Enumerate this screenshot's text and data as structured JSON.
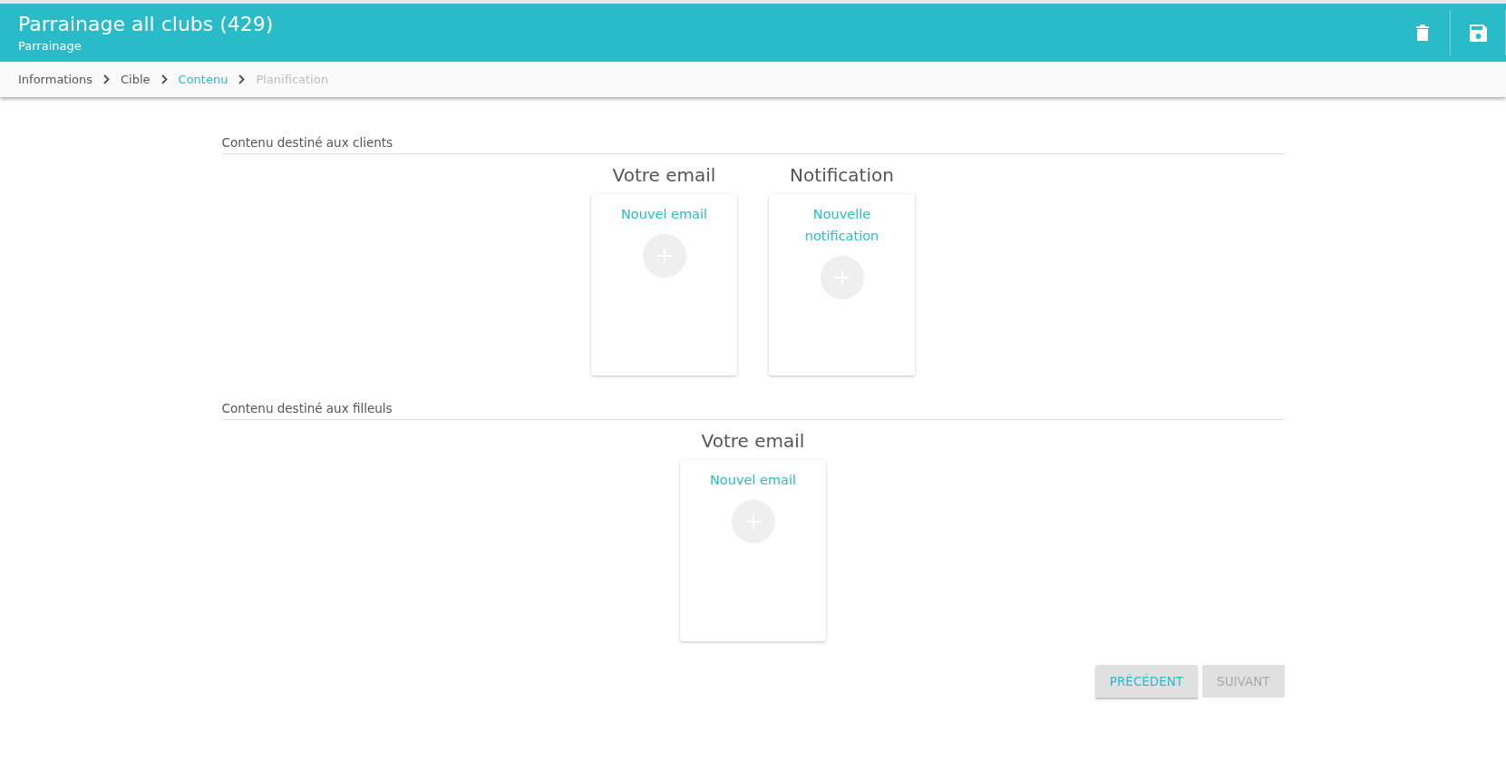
{
  "header": {
    "title": "Parrainage all clubs (429)",
    "subtitle": "Parrainage"
  },
  "toolbar": {
    "actions": [
      {
        "kind": "delete"
      },
      {
        "kind": "save"
      }
    ]
  },
  "breadcrumb": [
    {
      "label": "Informations",
      "selected": false,
      "disabled": false
    },
    {
      "label": "Cible",
      "selected": false,
      "disabled": false
    },
    {
      "label": "Contenu",
      "selected": true,
      "disabled": false
    },
    {
      "label": "Planification",
      "selected": false,
      "disabled": true
    }
  ],
  "sections": [
    {
      "title": "Contenu destiné aux clients",
      "cards": [
        {
          "heading": "Votre email",
          "label": "Nouvel email"
        },
        {
          "heading": "Notification",
          "label": "Nouvelle notification"
        }
      ]
    },
    {
      "title": "Contenu destiné aux filleuls",
      "cards": [
        {
          "heading": "Votre email",
          "label": "Nouvel email"
        }
      ]
    }
  ],
  "buttons": [
    {
      "label": "PRÉCÉDENT",
      "disabled": false
    },
    {
      "label": "SUIVANT",
      "disabled": true
    }
  ]
}
